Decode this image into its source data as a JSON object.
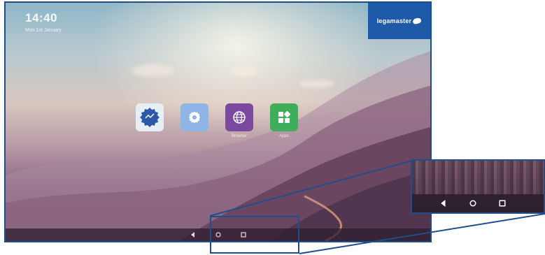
{
  "status_bar": {
    "time": "14:40",
    "date": "Mon 1st January"
  },
  "brand": {
    "name": "legamaster",
    "color": "#1e5aa8"
  },
  "apps": [
    {
      "label": "",
      "icon": "badge-icon",
      "color": "#2d5aa6"
    },
    {
      "label": "",
      "icon": "settings-icon",
      "color": "#8fb4e6"
    },
    {
      "label": "Browser",
      "icon": "globe-icon",
      "color": "#7b4aa0"
    },
    {
      "label": "Apps",
      "icon": "apps-grid-icon",
      "color": "#3fae5a"
    }
  ],
  "navbar": {
    "buttons": [
      "back-icon",
      "home-icon",
      "recents-icon"
    ]
  },
  "colors": {
    "frame": "#1f4e8c"
  }
}
